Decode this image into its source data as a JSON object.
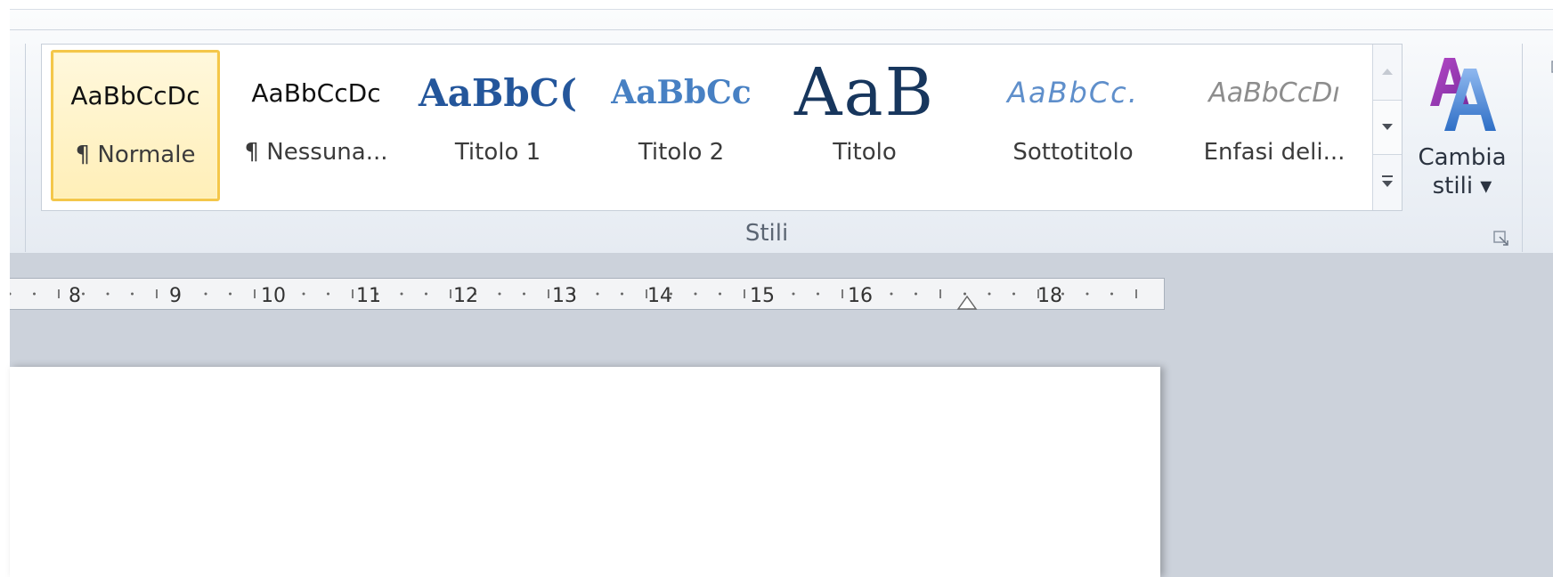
{
  "ribbon": {
    "styles_gallery": {
      "items": [
        {
          "preview": "AaBbCcDc",
          "label": "¶ Normale",
          "selected": true
        },
        {
          "preview": "AaBbCcDc",
          "label": "¶ Nessuna..."
        },
        {
          "preview": "AaBbC(",
          "label": "Titolo 1"
        },
        {
          "preview": "AaBbCc",
          "label": "Titolo 2"
        },
        {
          "preview": "AaB",
          "label": "Titolo"
        },
        {
          "preview": "AaBbCc.",
          "label": "Sottotitolo"
        },
        {
          "preview": "AaBbCcDı",
          "label": "Enfasi deli..."
        }
      ],
      "scroll_up_icon": "triangle-up",
      "scroll_down_icon": "triangle-down",
      "more_icon": "gallery-more"
    },
    "change_styles": {
      "label_line1": "Cambia",
      "label_line2": "stili ▾",
      "icon": "change-styles-AA"
    },
    "group_label": "Stili",
    "colors": {
      "selected_border": "#f4c74a",
      "ribbon_bg": "#eef2f7",
      "workspace_bg": "#ccd2db"
    }
  },
  "ruler": {
    "numbers": [
      "8",
      "9",
      "10",
      "11",
      "12",
      "13",
      "14",
      "15",
      "16",
      "18"
    ],
    "indent_marker_icon": "hanging-indent-triangle"
  }
}
